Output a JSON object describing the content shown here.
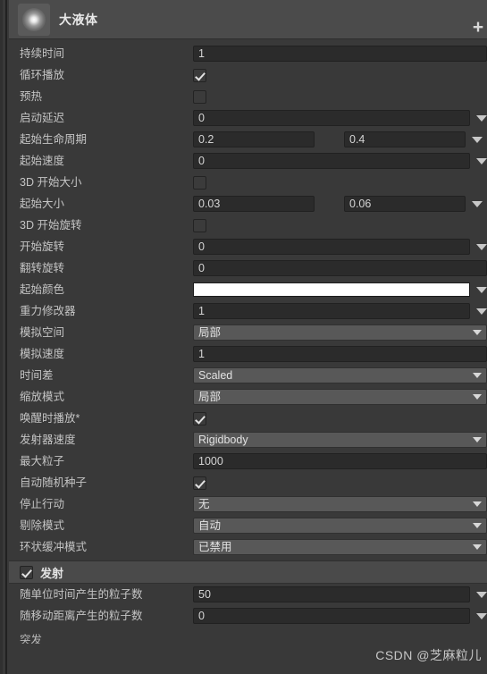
{
  "header": {
    "title": "大液体",
    "icon": "particle-system-icon",
    "add_button": "+"
  },
  "properties": [
    {
      "label": "持续时间",
      "type": "text",
      "value": "1"
    },
    {
      "label": "循环播放",
      "type": "checkbox",
      "checked": true
    },
    {
      "label": "预热",
      "type": "checkbox",
      "checked": false
    },
    {
      "label": "启动延迟",
      "type": "text-caret",
      "value": "0"
    },
    {
      "label": "起始生命周期",
      "type": "text-pair-caret",
      "value": "0.2",
      "value2": "0.4"
    },
    {
      "label": "起始速度",
      "type": "text-caret",
      "value": "0"
    },
    {
      "label": "3D 开始大小",
      "type": "checkbox",
      "checked": false
    },
    {
      "label": "起始大小",
      "type": "text-pair-caret",
      "value": "0.03",
      "value2": "0.06"
    },
    {
      "label": "3D 开始旋转",
      "type": "checkbox",
      "checked": false
    },
    {
      "label": "开始旋转",
      "type": "text-caret",
      "value": "0"
    },
    {
      "label": "翻转旋转",
      "type": "text-wide",
      "value": "0"
    },
    {
      "label": "起始颜色",
      "type": "color-caret",
      "value": "#ffffff"
    },
    {
      "label": "重力修改器",
      "type": "text-caret",
      "value": "1"
    },
    {
      "label": "模拟空间",
      "type": "popup",
      "value": "局部"
    },
    {
      "label": "模拟速度",
      "type": "text-wide",
      "value": "1"
    },
    {
      "label": "时间差",
      "type": "popup",
      "value": "Scaled"
    },
    {
      "label": "缩放模式",
      "type": "popup",
      "value": "局部"
    },
    {
      "label": "唤醒时播放*",
      "type": "checkbox",
      "checked": true
    },
    {
      "label": "发射器速度",
      "type": "popup",
      "value": "Rigidbody"
    },
    {
      "label": "最大粒子",
      "type": "text-wide",
      "value": "1000"
    },
    {
      "label": "自动随机种子",
      "type": "checkbox",
      "checked": true
    },
    {
      "label": "停止行动",
      "type": "popup",
      "value": "无"
    },
    {
      "label": "剔除模式",
      "type": "popup",
      "value": "自动"
    },
    {
      "label": "环状缓冲模式",
      "type": "popup",
      "value": "已禁用"
    }
  ],
  "emission_module": {
    "title": "发射",
    "enabled": true,
    "properties": [
      {
        "label": "随单位时间产生的粒子数",
        "type": "text-caret",
        "value": "50"
      },
      {
        "label": "随移动距离产生的粒子数",
        "type": "text-caret",
        "value": "0"
      }
    ],
    "clipped_label": "突发"
  },
  "watermark": "CSDN @芝麻粒儿",
  "colors": {
    "panel_bg": "#393939",
    "header_bg": "#4b4b4b",
    "field_bg": "#2b2b2b",
    "popup_bg": "#585858",
    "label_text": "#c4c4c4",
    "value_text": "#d4d4d4",
    "start_color_swatch": "#ffffff"
  }
}
